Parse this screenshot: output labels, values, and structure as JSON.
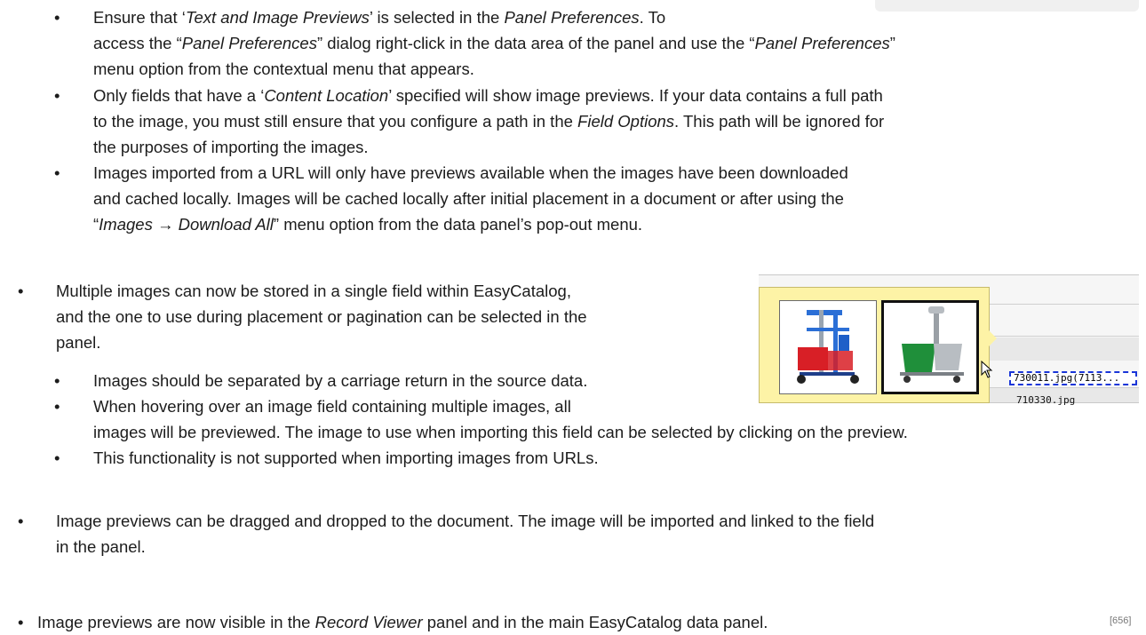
{
  "top_list": {
    "b1": [
      "Ensure that ‘",
      "Text and Image Previews",
      "’ is selected in the ",
      "Panel Preferences",
      ". To"
    ],
    "b1_l2": [
      "access the “",
      "Panel Preferences",
      "” dialog right-click in the data area of the panel and use the “",
      "Panel Preferences",
      "”"
    ],
    "b1_l3": "menu option from the contextual menu that appears.",
    "b2": [
      "Only fields that have a ‘",
      "Content Location",
      "’ specified will show image previews.  If your data contains a full path"
    ],
    "b2_l2": [
      "to the image, you must still ensure that you configure a path in the ",
      "Field Options",
      ". This path will be ignored for"
    ],
    "b2_l3": "the purposes of importing the images.",
    "b3_l1": "Images imported from a URL will only have previews available when the images have been downloaded",
    "b3_l2": "and cached locally.  Images will be cached locally after initial placement in a document or after using the",
    "b3_l3": [
      "“",
      "Images → Download All",
      "” menu option from the data panel’s pop-out menu."
    ]
  },
  "multi": {
    "l1": "Multiple images can now be stored in a single field within EasyCatalog,",
    "l2": "and the one to use during placement or pagination can be selected in the",
    "l3": "panel.",
    "s1": "Images should be separated by a carriage return in the source data.",
    "s2_l1": "When hovering over an image field containing multiple images, all",
    "s2_l2": "images will be previewed. The image to use when importing this field can be selected by clicking on the preview.",
    "s3": "This functionality is not supported when importing images from URLs."
  },
  "drag": {
    "l1": "Image previews can be dragged and dropped to the document.  The image will be imported and linked to the field",
    "l2": "in the panel."
  },
  "visible": [
    "Image previews are now visible in the ",
    "Record Viewer",
    " panel and in the main EasyCatalog data panel."
  ],
  "bullet": "•",
  "figure": {
    "cell_selected": "730011.jpg(7113...",
    "cell_below": "710330.jpg"
  },
  "page_number": "[656]",
  "colors": {
    "tooltip_bg": "#fdf3a6",
    "selection_dash": "#1a36d8",
    "bucket_red": "#d81f26",
    "bucket_green": "#1f8f3a",
    "cart_blue": "#2b6fd6"
  }
}
